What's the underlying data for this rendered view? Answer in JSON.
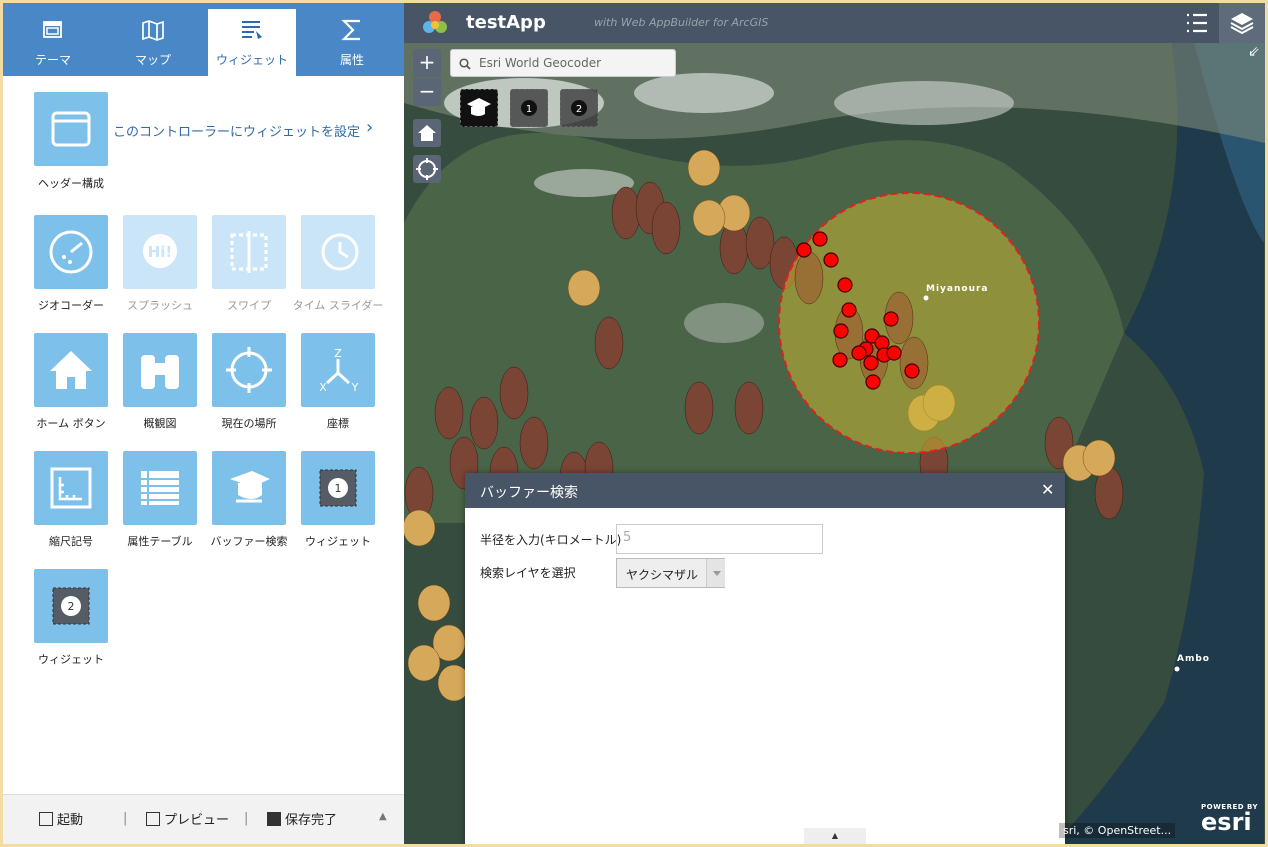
{
  "tabs": [
    {
      "label": "テーマ",
      "icon": "theme-icon"
    },
    {
      "label": "マップ",
      "icon": "map-icon"
    },
    {
      "label": "ウィジェット",
      "icon": "widget-icon",
      "active": true
    },
    {
      "label": "属性",
      "icon": "sigma-icon"
    }
  ],
  "header_widget": {
    "label": "ヘッダー構成",
    "link": "このコントローラーにウィジェットを設定"
  },
  "widgets": [
    {
      "label": "ジオコーダー",
      "icon": "geocoder-icon",
      "enabled": true
    },
    {
      "label": "スプラッシュ",
      "icon": "splash-icon",
      "enabled": false
    },
    {
      "label": "スワイプ",
      "icon": "swipe-icon",
      "enabled": false
    },
    {
      "label": "タイム スライダー",
      "icon": "time-slider-icon",
      "enabled": false
    },
    {
      "label": "ホーム ボタン",
      "icon": "home-icon",
      "enabled": true
    },
    {
      "label": "概観図",
      "icon": "binoculars-icon",
      "enabled": true
    },
    {
      "label": "現在の場所",
      "icon": "locate-icon",
      "enabled": true
    },
    {
      "label": "座標",
      "icon": "coordinate-icon",
      "enabled": true
    },
    {
      "label": "縮尺記号",
      "icon": "scalebar-icon",
      "enabled": true
    },
    {
      "label": "属性テーブル",
      "icon": "table-icon",
      "enabled": true
    },
    {
      "label": "バッファー検索",
      "icon": "buffer-search-icon",
      "enabled": true
    },
    {
      "label": "ウィジェット",
      "icon": "placeholder-1-icon",
      "enabled": true,
      "num": "1"
    },
    {
      "label": "ウィジェット",
      "icon": "placeholder-2-icon",
      "enabled": true,
      "num": "2"
    }
  ],
  "footer": {
    "launch": "起動",
    "preview": "プレビュー",
    "save": "保存完了"
  },
  "app": {
    "title": "testApp",
    "subtitle": "with Web AppBuilder for ArcGIS"
  },
  "search": {
    "placeholder": "Esri World Geocoder"
  },
  "map_labels": {
    "place1": "Miyanoura",
    "place2": "Ambo"
  },
  "map_widgets": [
    {
      "num": "1"
    },
    {
      "num": "2"
    }
  ],
  "panel": {
    "title": "バッファー検索",
    "radius_label": "半径を入力(キロメートル)",
    "radius_value": "5",
    "layer_label": "検索レイヤを選択",
    "layer_value": "ヤクシマザル"
  },
  "attribution": "sri, © OpenStreet...",
  "esri": {
    "powered": "POWERED BY",
    "brand": "esri"
  },
  "colors": {
    "tab_bar": "#4a87c6",
    "tile": "#7dc0ea",
    "appbar": "#485566",
    "buffer_fill": "#c8b432",
    "buffer_stroke": "#e02020",
    "point": "#ff0000"
  }
}
